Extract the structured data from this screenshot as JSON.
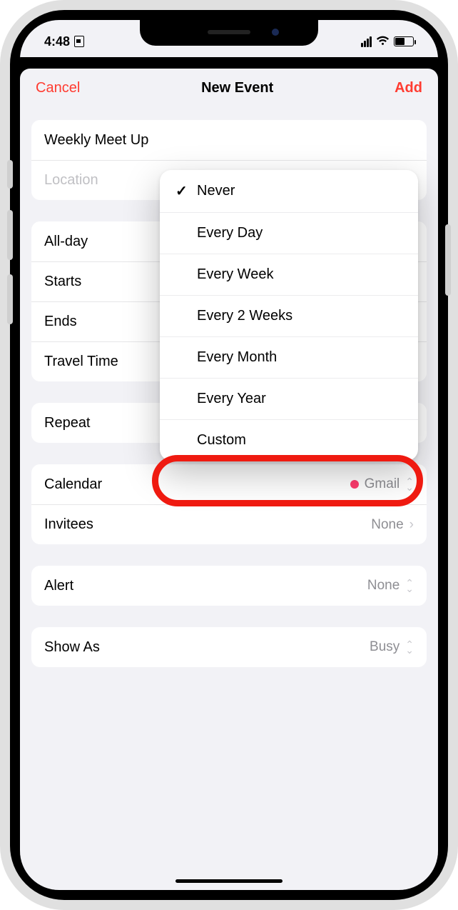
{
  "statusbar": {
    "time": "4:48"
  },
  "nav": {
    "cancel": "Cancel",
    "title": "New Event",
    "add": "Add"
  },
  "event": {
    "title_value": "Weekly Meet Up",
    "location_placeholder": "Location"
  },
  "rows": {
    "allday": "All-day",
    "starts": "Starts",
    "ends": "Ends",
    "travel": "Travel Time",
    "repeat": "Repeat",
    "repeat_value": "Never",
    "calendar": "Calendar",
    "calendar_value": "Gmail",
    "calendar_dot_color": "#ff3b6e",
    "invitees": "Invitees",
    "invitees_value": "None",
    "alert": "Alert",
    "alert_value": "None",
    "showas": "Show As",
    "showas_value": "Busy"
  },
  "menu": {
    "items": [
      {
        "label": "Never",
        "checked": true
      },
      {
        "label": "Every Day",
        "checked": false
      },
      {
        "label": "Every Week",
        "checked": false
      },
      {
        "label": "Every 2 Weeks",
        "checked": false
      },
      {
        "label": "Every Month",
        "checked": false
      },
      {
        "label": "Every Year",
        "checked": false
      },
      {
        "label": "Custom",
        "checked": false
      }
    ]
  }
}
